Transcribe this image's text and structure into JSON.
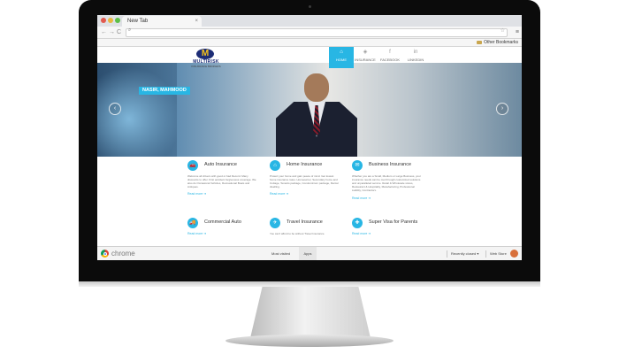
{
  "browser": {
    "tab_title": "New Tab",
    "tab_close": "×",
    "back": "←",
    "forward": "→",
    "reload": "C",
    "search_glyph": "⌕",
    "star": "☆",
    "menu": "≡",
    "other_bookmarks": "Other Bookmarks"
  },
  "site": {
    "logo": {
      "mark": "M",
      "name": "MULTIRISK",
      "tagline": "INSURANCE BROKERS"
    },
    "nav": [
      {
        "label": "HOME",
        "icon": "home-icon",
        "glyph": "⌂",
        "active": true
      },
      {
        "label": "INSURANCE",
        "icon": "shield-icon",
        "glyph": "◈",
        "active": false
      },
      {
        "label": "FACEBOOK",
        "icon": "facebook-icon",
        "glyph": "f",
        "active": false
      },
      {
        "label": "LINKEDIN",
        "icon": "linkedin-icon",
        "glyph": "in",
        "active": false
      }
    ],
    "hero": {
      "name": "NASIR, MAHMOOD",
      "prev": "‹",
      "next": "›"
    },
    "features": [
      {
        "title": "Auto Insurance",
        "glyph": "🚗",
        "icon": "car-icon",
        "text": "Welcome all drivers with good or bad Record. Many discounts to offer. First accident forgiveness coverage. We also do Occasional Vehicles, Recreational Boats and Antiques.",
        "more": "Read more ➜"
      },
      {
        "title": "Home Insurance",
        "glyph": "⌂",
        "icon": "home-icon",
        "text": "Protect your home and gain peace of mind. Get lowest home insurance rates. Homeowner, Secondary home and Cottage, Tenants package, Condominium package, Rental dwelling.",
        "more": "Read more ➜"
      },
      {
        "title": "Business Insurance",
        "glyph": "✉",
        "icon": "briefcase-icon",
        "text": "Whether you are a Small, Medium or Large Business, your insurance needs can be met through customized solutions and unparalleled service. Retail & Wholesale stores, Restaurant & Hospitality, Manufacturing, Professional Liability, Contractors.",
        "more": "Read more ➜"
      },
      {
        "title": "Commercial Auto",
        "glyph": "🚚",
        "icon": "truck-icon",
        "text": "",
        "more": "Read more ➜"
      },
      {
        "title": "Travel Insurance",
        "glyph": "✈",
        "icon": "plane-icon",
        "text": "You can't afford to be without Travel Insurance.",
        "more": ""
      },
      {
        "title": "Super Visa for Parents",
        "glyph": "✚",
        "icon": "medical-icon",
        "text": "",
        "more": "Read more ➜"
      }
    ]
  },
  "shelf": {
    "chrome_label": "chrome",
    "most_visited": "Most visited",
    "apps": "Apps",
    "recently_closed": "Recently closed ▾",
    "web_store": "Web Store"
  },
  "colors": {
    "accent": "#28b6e4",
    "logo_blue": "#1d2d76",
    "logo_gold": "#f5c21b"
  }
}
